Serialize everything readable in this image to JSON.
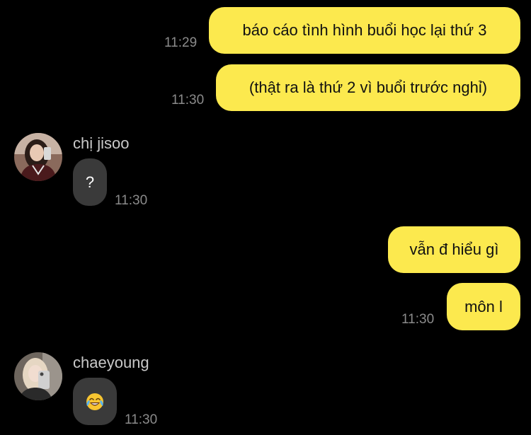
{
  "colors": {
    "background": "#000000",
    "outgoing_bubble": "#fce94e",
    "incoming_bubble": "#3a3a3a",
    "timestamp": "#8b8b8b",
    "sender_name": "#c9c9c9"
  },
  "messages": [
    {
      "direction": "outgoing",
      "text": "báo cáo tình hình buổi học lại thứ 3",
      "time": "11:29"
    },
    {
      "direction": "outgoing",
      "text": "(thật ra là thứ 2 vì buổi trước nghỉ)",
      "time": "11:30"
    },
    {
      "direction": "incoming",
      "sender": "chị jisoo",
      "avatar_icon": "profile-photo-icon",
      "text": "?",
      "time": "11:30"
    },
    {
      "direction": "outgoing",
      "text": "vẫn đ hiểu gì"
    },
    {
      "direction": "outgoing",
      "text": "môn l",
      "time": "11:30"
    },
    {
      "direction": "incoming",
      "sender": "chaeyoung",
      "avatar_icon": "profile-photo-icon",
      "emoji": "face-with-tears-of-joy-icon",
      "time": "11:30"
    }
  ]
}
